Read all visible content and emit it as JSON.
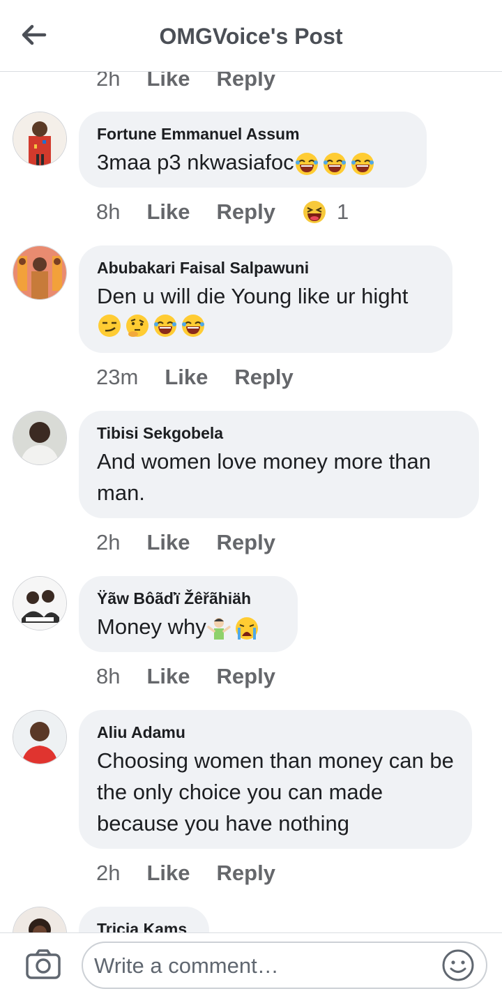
{
  "header": {
    "title": "OMGVoice's Post"
  },
  "top_partial": {
    "time": "2h",
    "like_label": "Like",
    "reply_label": "Reply"
  },
  "comments": [
    {
      "name": "Fortune Emmanuel Assum",
      "text": "3maa p3 nkwasiafoc",
      "text_emojis": [
        "laughing-tears",
        "laughing-tears",
        "laughing-tears"
      ],
      "time": "8h",
      "like_label": "Like",
      "reply_label": "Reply",
      "reaction": "haha-reaction",
      "reaction_count": "1"
    },
    {
      "name": "Abubakari Faisal Salpawuni",
      "text": "Den u will die Young like ur hight",
      "text_emojis": [
        "smirk",
        "thinking",
        "laughing-tears",
        "laughing-tears"
      ],
      "time": "23m",
      "like_label": "Like",
      "reply_label": "Reply"
    },
    {
      "name": "Tibisi Sekgobela",
      "text": "And women love money more than man.",
      "time": "2h",
      "like_label": "Like",
      "reply_label": "Reply"
    },
    {
      "name": "Ÿãw Bôãďï Žêřãhiäh",
      "text": "Money why",
      "text_emojis": [
        "shrug",
        "crying"
      ],
      "time": "8h",
      "like_label": "Like",
      "reply_label": "Reply"
    },
    {
      "name": "Aliu Adamu",
      "text": "Choosing women than money can be the only choice you can made because you have nothing",
      "time": "2h",
      "like_label": "Like",
      "reply_label": "Reply"
    },
    {
      "name": "Tricia Kams"
    }
  ],
  "composer": {
    "placeholder": "Write a comment…"
  },
  "colors": {
    "bubble": "#f0f2f5",
    "meta": "#65676b",
    "header_text": "#4b4f56"
  }
}
